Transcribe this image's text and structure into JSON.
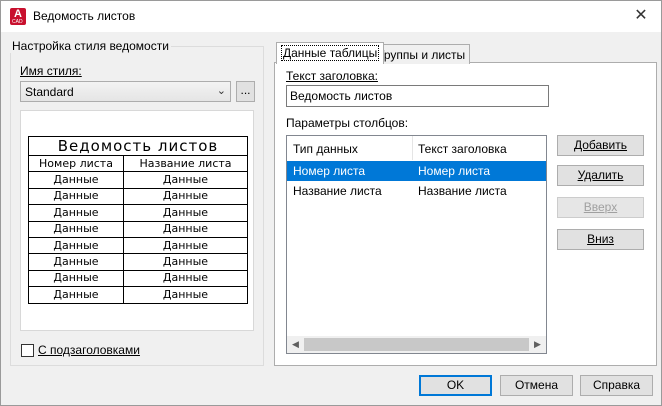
{
  "window": {
    "title": "Ведомость листов",
    "app_icon_letter": "A",
    "app_icon_sub": "CAD"
  },
  "style_group": {
    "legend": "Настройка стиля ведомости",
    "style_name_label": "Имя стиля:",
    "style_name_value": "Standard",
    "browse_label": "...",
    "subheadings_label": "С подзаголовками"
  },
  "preview": {
    "title": "Ведомость листов",
    "headers": [
      "Номер листа",
      "Название листа"
    ],
    "rows": [
      [
        "Данные",
        "Данные"
      ],
      [
        "Данные",
        "Данные"
      ],
      [
        "Данные",
        "Данные"
      ],
      [
        "Данные",
        "Данные"
      ],
      [
        "Данные",
        "Данные"
      ],
      [
        "Данные",
        "Данные"
      ],
      [
        "Данные",
        "Данные"
      ],
      [
        "Данные",
        "Данные"
      ]
    ]
  },
  "tabs": [
    {
      "label": "Данные таблицы",
      "active": true
    },
    {
      "label": "Группы и листы",
      "active": false
    }
  ],
  "data_tab": {
    "header_text_label": "Текст заголовка:",
    "header_text_value": "Ведомость листов",
    "columns_label": "Параметры столбцов:",
    "columns_headers": [
      "Тип данных",
      "Текст заголовка"
    ],
    "columns_rows": [
      {
        "type": "Номер листа",
        "header": "Номер листа",
        "selected": true
      },
      {
        "type": "Название листа",
        "header": "Название листа",
        "selected": false
      }
    ],
    "buttons": {
      "add": "Добавить",
      "remove": "Удалить",
      "up": "Вверх",
      "down": "Вниз"
    }
  },
  "footer": {
    "ok": "OK",
    "cancel": "Отмена",
    "help": "Справка"
  },
  "colors": {
    "selection": "#0078d7",
    "app_icon": "#c8102e"
  }
}
